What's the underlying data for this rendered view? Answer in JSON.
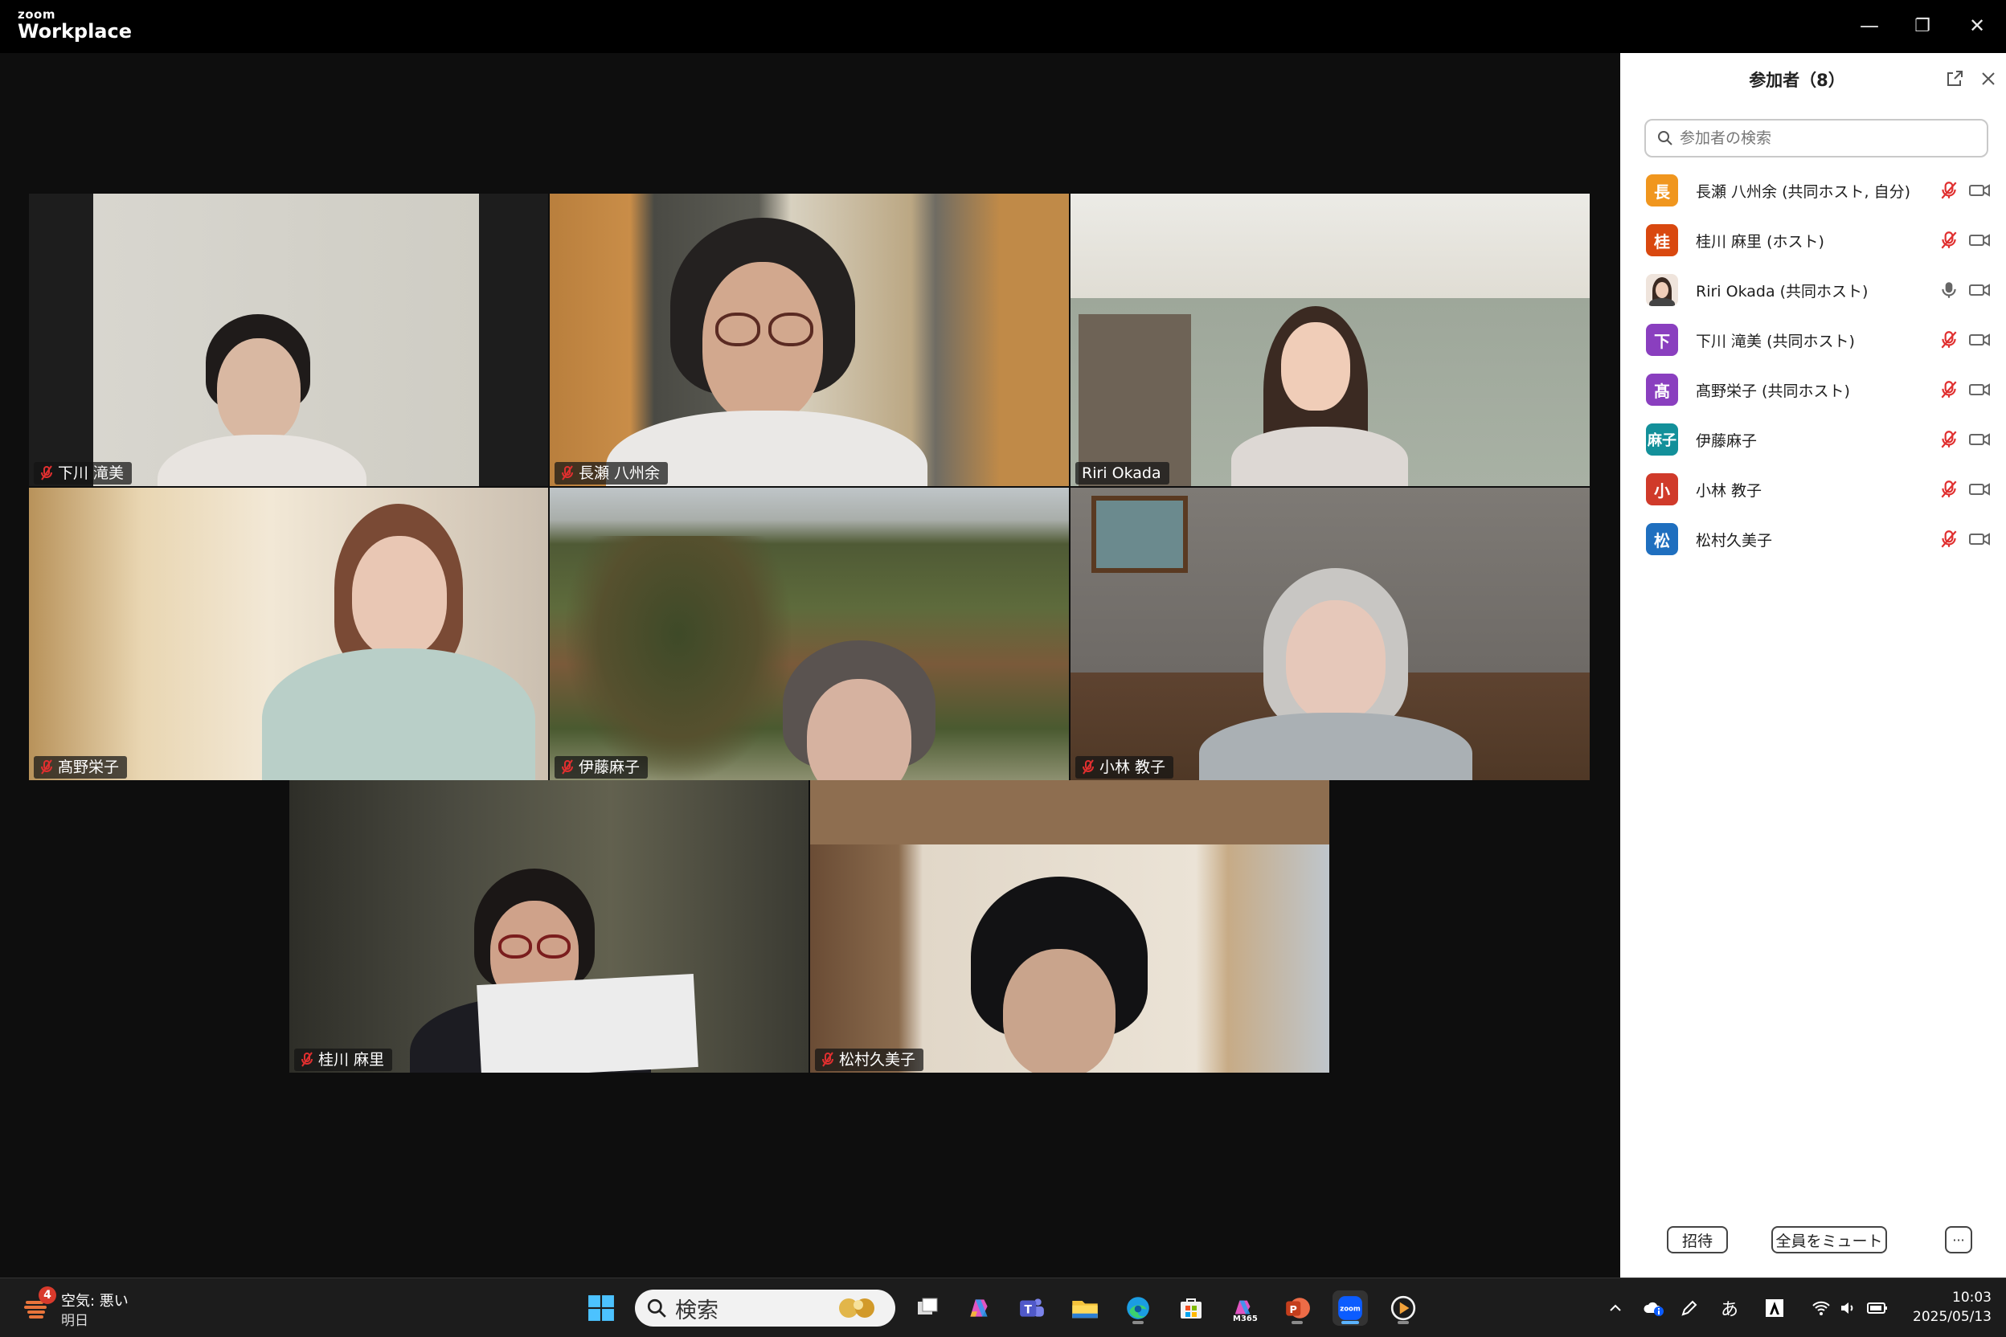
{
  "app": {
    "brand_small": "zoom",
    "brand_big": "Workplace"
  },
  "window_controls": {
    "minimize": "—",
    "restore": "❐",
    "close": "✕"
  },
  "tiles": [
    {
      "name": "下川 滝美",
      "muted": true,
      "active": false
    },
    {
      "name": "長瀬 八州余",
      "muted": true,
      "active": false
    },
    {
      "name": "Riri Okada",
      "muted": false,
      "active": true
    },
    {
      "name": "髙野栄子",
      "muted": true,
      "active": false
    },
    {
      "name": "伊藤麻子",
      "muted": true,
      "active": false
    },
    {
      "name": "小林 教子",
      "muted": true,
      "active": false
    },
    {
      "name": "桂川 麻里",
      "muted": true,
      "active": false
    },
    {
      "name": "松村久美子",
      "muted": true,
      "active": false
    }
  ],
  "panel": {
    "title": "参加者（8）",
    "search_placeholder": "参加者の検索",
    "participants": [
      {
        "avatar": "長",
        "color": "#f0961e",
        "name": "長瀬 八州余 (共同ホスト, 自分)",
        "mic": "muted"
      },
      {
        "avatar": "桂",
        "color": "#d9480f",
        "name": "桂川 麻里 (ホスト)",
        "mic": "muted"
      },
      {
        "avatar": "",
        "color": "#c9a98f",
        "name": "Riri Okada (共同ホスト)",
        "mic": "on"
      },
      {
        "avatar": "下",
        "color": "#8a3fbf",
        "name": "下川 滝美 (共同ホスト)",
        "mic": "muted"
      },
      {
        "avatar": "髙",
        "color": "#8a3fbf",
        "name": "髙野栄子 (共同ホスト)",
        "mic": "muted"
      },
      {
        "avatar": "麻子",
        "color": "#13909a",
        "name": "伊藤麻子",
        "mic": "muted"
      },
      {
        "avatar": "小",
        "color": "#d03a2a",
        "name": "小林 教子",
        "mic": "muted"
      },
      {
        "avatar": "松",
        "color": "#1f6fbf",
        "name": "松村久美子",
        "mic": "muted"
      }
    ],
    "invite_label": "招待",
    "mute_all_label": "全員をミュート",
    "more_label": "···"
  },
  "taskbar": {
    "weather_badge": "4",
    "weather_line1": "空気: 悪い",
    "weather_line2": "明日",
    "search_label": "検索",
    "ime": "あ",
    "time": "10:03",
    "date": "2025/05/13",
    "m365_label": "M365"
  },
  "colors": {
    "accent_green": "#23d18b",
    "mute_red": "#e02f2f"
  }
}
